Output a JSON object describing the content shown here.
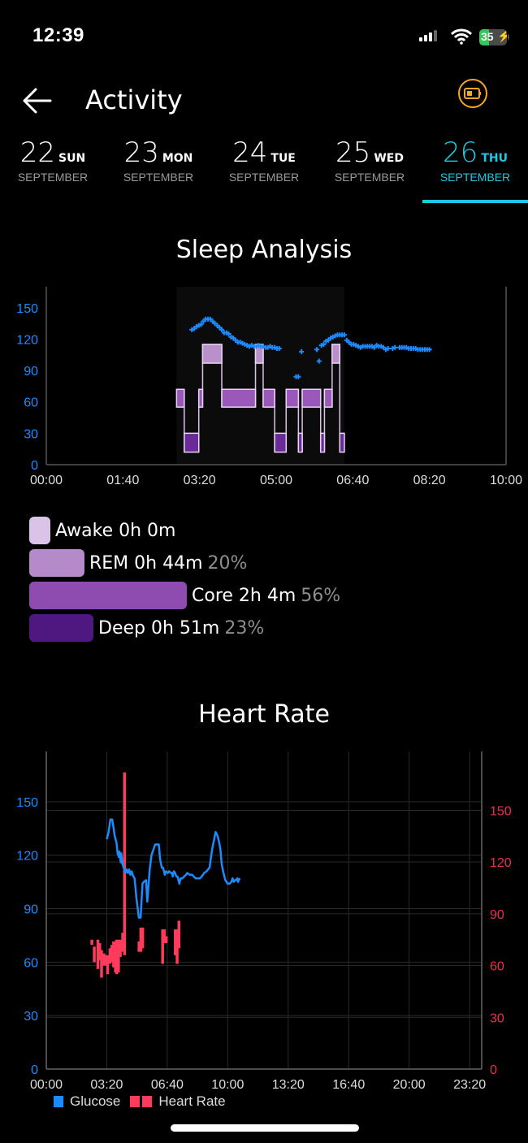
{
  "status_bar": {
    "time": "12:39",
    "battery": "35"
  },
  "header": {
    "title": "Activity",
    "back_icon": "arrow-left-icon",
    "action_icon": "battery-icon"
  },
  "colors": {
    "accent": "#1ec8e0",
    "glucose": "#1a8cff",
    "heart_rate": "#ff3b5c",
    "awake": "#d9c4e8",
    "rem": "#b48ac8",
    "core": "#8e4bb0",
    "deep": "#4e1880",
    "action": "#f5a623"
  },
  "date_tabs": [
    {
      "num": "22",
      "day": "SUN",
      "month": "SEPTEMBER",
      "active": false
    },
    {
      "num": "23",
      "day": "MON",
      "month": "SEPTEMBER",
      "active": false
    },
    {
      "num": "24",
      "day": "TUE",
      "month": "SEPTEMBER",
      "active": false
    },
    {
      "num": "25",
      "day": "WED",
      "month": "SEPTEMBER",
      "active": false
    },
    {
      "num": "26",
      "day": "THU",
      "month": "SEPTEMBER",
      "active": true
    }
  ],
  "sleep": {
    "title": "Sleep Analysis",
    "legend": [
      {
        "key": "awake",
        "label": "Awake 0h 0m",
        "pct": "",
        "minutes": 0
      },
      {
        "key": "rem",
        "label": "REM 0h 44m",
        "pct": "20%",
        "minutes": 44
      },
      {
        "key": "core",
        "label": "Core 2h 4m",
        "pct": "56%",
        "minutes": 124
      },
      {
        "key": "deep",
        "label": "Deep 0h 51m",
        "pct": "23%",
        "minutes": 51
      }
    ]
  },
  "heart": {
    "title": "Heart Rate",
    "legend": {
      "glucose": "Glucose",
      "heart_rate": "Heart Rate"
    }
  },
  "chart_data": [
    {
      "type": "scatter",
      "title": "Sleep Analysis",
      "xlabel": "",
      "ylabel": "",
      "x_ticks": [
        "00:00",
        "01:40",
        "03:20",
        "05:00",
        "06:40",
        "08:20",
        "10:00"
      ],
      "xlim_minutes": [
        0,
        600
      ],
      "y_ticks": [
        "0",
        "30",
        "60",
        "90",
        "120",
        "150"
      ],
      "ylim": [
        0,
        170
      ],
      "sleep_stages": [
        {
          "stage": "core",
          "start": 170,
          "end": 180
        },
        {
          "stage": "deep",
          "start": 180,
          "end": 199
        },
        {
          "stage": "core",
          "start": 199,
          "end": 204
        },
        {
          "stage": "rem",
          "start": 204,
          "end": 229
        },
        {
          "stage": "core",
          "start": 229,
          "end": 273
        },
        {
          "stage": "rem",
          "start": 273,
          "end": 283
        },
        {
          "stage": "core",
          "start": 283,
          "end": 298
        },
        {
          "stage": "deep",
          "start": 298,
          "end": 313
        },
        {
          "stage": "core",
          "start": 313,
          "end": 329
        },
        {
          "stage": "deep",
          "start": 329,
          "end": 334
        },
        {
          "stage": "core",
          "start": 334,
          "end": 358
        },
        {
          "stage": "deep",
          "start": 358,
          "end": 363
        },
        {
          "stage": "core",
          "start": 363,
          "end": 373
        },
        {
          "stage": "rem",
          "start": 373,
          "end": 383
        },
        {
          "stage": "deep",
          "start": 383,
          "end": 389
        }
      ],
      "stage_levels": {
        "deep": [
          12,
          30
        ],
        "core": [
          55,
          72
        ],
        "rem": [
          97,
          115
        ]
      },
      "series": [
        {
          "name": "Glucose",
          "points": [
            [
              190,
              129
            ],
            [
              193,
              130
            ],
            [
              196,
              132
            ],
            [
              199,
              133
            ],
            [
              202,
              134
            ],
            [
              205,
              137
            ],
            [
              208,
              139
            ],
            [
              211,
              139
            ],
            [
              214,
              139
            ],
            [
              217,
              137
            ],
            [
              220,
              135
            ],
            [
              223,
              133
            ],
            [
              226,
              131
            ],
            [
              229,
              129
            ],
            [
              232,
              126
            ],
            [
              235,
              126
            ],
            [
              238,
              125
            ],
            [
              241,
              122
            ],
            [
              244,
              121
            ],
            [
              247,
              119
            ],
            [
              250,
              117
            ],
            [
              253,
              117
            ],
            [
              256,
              116
            ],
            [
              259,
              115
            ],
            [
              262,
              114
            ],
            [
              265,
              113
            ],
            [
              268,
              114
            ],
            [
              271,
              113
            ],
            [
              274,
              113
            ],
            [
              277,
              114
            ],
            [
              280,
              113
            ],
            [
              283,
              113
            ],
            [
              286,
              112
            ],
            [
              289,
              112
            ],
            [
              292,
              113
            ],
            [
              295,
              112
            ],
            [
              298,
              112
            ],
            [
              301,
              111
            ],
            [
              304,
              111
            ],
            [
              326,
              84
            ],
            [
              329,
              84
            ],
            [
              333,
              108
            ],
            [
              353,
              110
            ],
            [
              356,
              99
            ],
            [
              359,
              114
            ],
            [
              362,
              115
            ],
            [
              365,
              118
            ],
            [
              368,
              119
            ],
            [
              371,
              121
            ],
            [
              374,
              122
            ],
            [
              377,
              123
            ],
            [
              380,
              124
            ],
            [
              383,
              124
            ],
            [
              386,
              124
            ],
            [
              389,
              124
            ],
            [
              392,
              119
            ],
            [
              395,
              117
            ],
            [
              398,
              115
            ],
            [
              401,
              115
            ],
            [
              404,
              114
            ],
            [
              407,
              113
            ],
            [
              410,
              112
            ],
            [
              413,
              113
            ],
            [
              416,
              113
            ],
            [
              419,
              113
            ],
            [
              422,
              113
            ],
            [
              425,
              113
            ],
            [
              428,
              112
            ],
            [
              431,
              114
            ],
            [
              434,
              113
            ],
            [
              437,
              113
            ],
            [
              440,
              112
            ],
            [
              443,
              110
            ],
            [
              446,
              111
            ],
            [
              452,
              111
            ],
            [
              455,
              112
            ],
            [
              461,
              112
            ],
            [
              464,
              112
            ],
            [
              467,
              112
            ],
            [
              470,
              112
            ],
            [
              473,
              111
            ],
            [
              476,
              111
            ],
            [
              479,
              111
            ],
            [
              482,
              111
            ],
            [
              485,
              110
            ],
            [
              488,
              110
            ],
            [
              491,
              110
            ],
            [
              494,
              110
            ],
            [
              497,
              110
            ],
            [
              500,
              110
            ]
          ]
        }
      ]
    },
    {
      "type": "line",
      "title": "Heart Rate",
      "xlabel": "",
      "ylabel": "",
      "x_ticks": [
        "00:00",
        "03:20",
        "06:40",
        "10:00",
        "13:20",
        "16:40",
        "20:00",
        "23:20"
      ],
      "xlim_minutes": [
        0,
        1440
      ],
      "y_ticks_left": [
        "0",
        "30",
        "60",
        "90",
        "120",
        "150"
      ],
      "y_ticks_right": [
        "0",
        "30",
        "60",
        "90",
        "120",
        "150"
      ],
      "ylim_left": [
        0,
        170
      ],
      "ylim_right": [
        0,
        170
      ],
      "legend": [
        "Glucose",
        "Heart Rate"
      ],
      "legend_position": "bottom-left",
      "series": [
        {
          "name": "Glucose",
          "axis": "left",
          "points": [
            [
              200,
              129
            ],
            [
              206,
              133
            ],
            [
              212,
              140
            ],
            [
              218,
              140
            ],
            [
              222,
              136
            ],
            [
              226,
              131
            ],
            [
              232,
              127
            ],
            [
              236,
              121
            ],
            [
              240,
              119
            ],
            [
              242,
              122
            ],
            [
              246,
              116
            ],
            [
              248,
              121
            ],
            [
              252,
              115
            ],
            [
              256,
              113
            ],
            [
              262,
              110
            ],
            [
              266,
              112
            ],
            [
              270,
              110
            ],
            [
              274,
              112
            ],
            [
              278,
              109
            ],
            [
              282,
              111
            ],
            [
              288,
              108
            ],
            [
              292,
              107
            ],
            [
              298,
              96
            ],
            [
              306,
              85
            ],
            [
              312,
              85
            ],
            [
              318,
              104
            ],
            [
              322,
              105
            ],
            [
              330,
              106
            ],
            [
              334,
              94
            ],
            [
              338,
              103
            ],
            [
              342,
              112
            ],
            [
              348,
              120
            ],
            [
              354,
              123
            ],
            [
              360,
              126
            ],
            [
              368,
              126
            ],
            [
              372,
              126
            ],
            [
              376,
              118
            ],
            [
              382,
              113
            ],
            [
              386,
              113
            ],
            [
              392,
              109
            ],
            [
              396,
              111
            ],
            [
              402,
              110
            ],
            [
              406,
              111
            ],
            [
              412,
              110
            ],
            [
              416,
              110
            ],
            [
              418,
              108
            ],
            [
              422,
              111
            ],
            [
              426,
              110
            ],
            [
              430,
              108
            ],
            [
              434,
              108
            ],
            [
              440,
              104
            ],
            [
              444,
              107
            ],
            [
              450,
              107
            ],
            [
              456,
              108
            ],
            [
              462,
              109
            ],
            [
              466,
              110
            ],
            [
              474,
              109
            ],
            [
              482,
              109
            ],
            [
              488,
              108
            ],
            [
              494,
              107
            ],
            [
              502,
              107
            ],
            [
              508,
              107
            ],
            [
              514,
              108
            ],
            [
              522,
              110
            ],
            [
              530,
              111
            ],
            [
              540,
              113
            ],
            [
              548,
              123
            ],
            [
              554,
              128
            ],
            [
              560,
              133
            ],
            [
              566,
              131
            ],
            [
              572,
              127
            ],
            [
              576,
              123
            ],
            [
              580,
              115
            ],
            [
              586,
              110
            ],
            [
              592,
              106
            ],
            [
              600,
              104
            ],
            [
              606,
              104
            ],
            [
              612,
              105
            ],
            [
              616,
              107
            ],
            [
              620,
              105
            ],
            [
              624,
              106
            ],
            [
              628,
              106
            ],
            [
              632,
              107
            ],
            [
              634,
              105
            ],
            [
              640,
              107
            ]
          ]
        },
        {
          "name": "Heart Rate",
          "axis": "right",
          "type": "range-bar",
          "ranges": [
            [
              150,
              72,
              75
            ],
            [
              158,
              62,
              71
            ],
            [
              170,
              58,
              75
            ],
            [
              176,
              63,
              73
            ],
            [
              182,
              53,
              69
            ],
            [
              190,
              60,
              67
            ],
            [
              196,
              60,
              66
            ],
            [
              202,
              55,
              66
            ],
            [
              210,
              61,
              70
            ],
            [
              216,
              62,
              72
            ],
            [
              222,
              59,
              74
            ],
            [
              228,
              56,
              74
            ],
            [
              232,
              55,
              75
            ],
            [
              238,
              56,
              75
            ],
            [
              244,
              65,
              75
            ],
            [
              252,
              68,
              79
            ],
            [
              258,
              66,
              172
            ],
            [
              306,
              68,
              74
            ],
            [
              312,
              68,
              82
            ],
            [
              318,
              70,
              82
            ],
            [
              384,
              61,
              81
            ],
            [
              390,
              73,
              81
            ],
            [
              396,
              73,
              77
            ],
            [
              426,
              66,
              81
            ],
            [
              432,
              61,
              81
            ],
            [
              438,
              70,
              86
            ]
          ]
        }
      ]
    }
  ]
}
